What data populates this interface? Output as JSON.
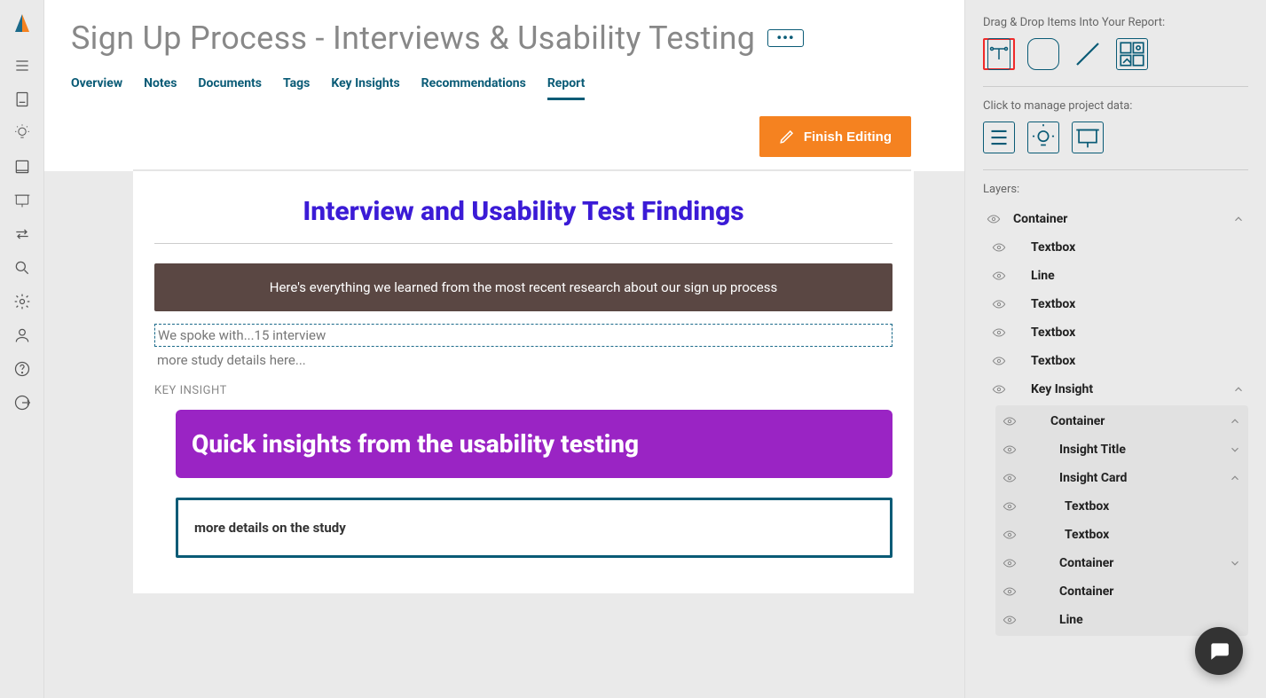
{
  "title": "Sign Up Process - Interviews & Usability Testing",
  "more_button": "•••",
  "tabs": {
    "overview": "Overview",
    "notes": "Notes",
    "documents": "Documents",
    "tags": "Tags",
    "insights": "Key Insights",
    "recommendations": "Recommendations",
    "report": "Report"
  },
  "finish_editing": "Finish Editing",
  "report": {
    "title": "Interview and Usability Test Findings",
    "intro_box": "Here's everything we learned from the most recent research about our sign up process",
    "spoke_line1": "We spoke with...15 interview",
    "spoke_line2": "more study details here...",
    "ki_label": "KEY INSIGHT",
    "insight_title": "Quick insights from the usability testing",
    "insight_detail": "more details on the study"
  },
  "side": {
    "drag_label": "Drag & Drop Items Into Your Report:",
    "manage_label": "Click to manage project data:",
    "layers_label": "Layers:"
  },
  "layers": {
    "l0": "Container",
    "l1": "Textbox",
    "l2": "Line",
    "l3": "Textbox",
    "l4": "Textbox",
    "l5": "Textbox",
    "l6": "Key Insight",
    "n0": "Container",
    "n1": "Insight Title",
    "n2": "Insight Card",
    "n3": "Textbox",
    "n4": "Textbox",
    "n5": "Container",
    "n6": "Container",
    "n7": "Line"
  }
}
